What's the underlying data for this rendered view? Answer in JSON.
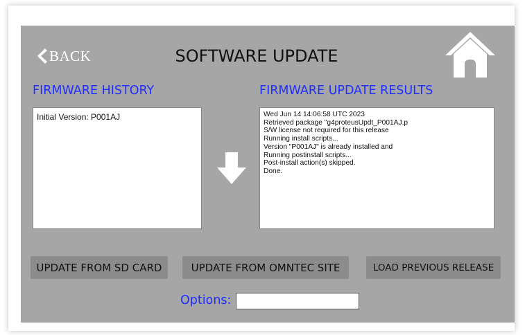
{
  "header": {
    "back_label": "BACK",
    "title": "SOFTWARE UPDATE"
  },
  "history": {
    "label": "FIRMWARE HISTORY",
    "lines": [
      "Initial Version: P001AJ"
    ]
  },
  "results": {
    "label": "FIRMWARE UPDATE RESULTS",
    "lines": [
      "Wed Jun 14 14:06:58 UTC 2023",
      "Retrieved package \"g4proteusUpdt_P001AJ.p",
      "S/W license not required for this release",
      "Running install scripts...",
      "Version \"P001AJ\" is already installed and",
      "Running postinstall scripts...",
      "Post-install action(s) skipped.",
      "Done."
    ]
  },
  "buttons": {
    "sd_card": "UPDATE FROM SD CARD",
    "omntec": "UPDATE FROM OMNTEC SITE",
    "previous": "LOAD PREVIOUS RELEASE"
  },
  "options": {
    "label": "Options:",
    "value": ""
  },
  "icons": {
    "back": "chevron-left-icon",
    "home": "home-icon",
    "arrow": "arrow-down-icon"
  },
  "colors": {
    "panel": "#a6a6a6",
    "label_blue": "#1f2dff",
    "button": "#8c8c8c"
  }
}
